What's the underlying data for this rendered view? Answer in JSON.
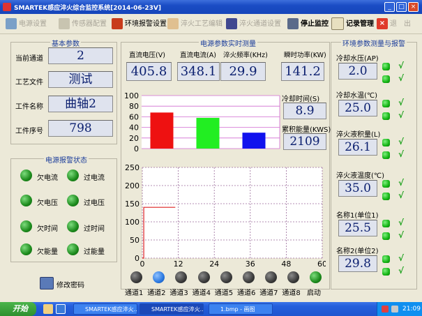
{
  "window": {
    "title": "SMARTEK感应淬火综合监控系统[2014-06-23V]",
    "min": "_",
    "max": "□",
    "close": "×"
  },
  "toolbar": {
    "power_settings": "电源设置",
    "sensor_config": "传感器配置",
    "env_alarm_settings": "环境报警设置",
    "quench_process_edit": "淬火工艺编辑",
    "quench_channel_settings": "淬火通道设置",
    "stop_monitor": "停止监控",
    "record_management": "记录管理",
    "exit": "退",
    "exit2": "出"
  },
  "basic_params": {
    "title": "基本参数",
    "rows": [
      {
        "label": "当前通道",
        "value": "2"
      },
      {
        "label": "工艺文件",
        "value": "测试"
      },
      {
        "label": "工件名称",
        "value": "曲轴2"
      },
      {
        "label": "工件序号",
        "value": "798"
      }
    ]
  },
  "realtime": {
    "title": "电源参数实时测量",
    "metrics": [
      {
        "label": "直流电压(V)",
        "value": "405.8"
      },
      {
        "label": "直流电流(A)",
        "value": "348.1"
      },
      {
        "label": "淬火频率(KHz)",
        "value": "29.9"
      },
      {
        "label": "瞬时功率(KW)",
        "value": "141.2"
      }
    ],
    "cooling_time": {
      "label": "冷却时间(S)",
      "value": "8.9"
    },
    "accum_energy": {
      "label": "累积能量(KWS)",
      "value": "2109"
    }
  },
  "alarm": {
    "title": "电源报警状态",
    "items": [
      "欠电流",
      "过电流",
      "欠电压",
      "过电压",
      "欠时间",
      "过时间",
      "欠能量",
      "过能量"
    ],
    "change_password": "修改密码"
  },
  "environment": {
    "title": "环境参数测量与报警",
    "items": [
      {
        "label": "冷却水压(AP)",
        "value": "2.0"
      },
      {
        "label": "冷却水温(℃)",
        "value": "25.0"
      },
      {
        "label": "淬火液积量(L)",
        "value": "26.1"
      },
      {
        "label": "淬火液温度(℃)",
        "value": "35.0"
      },
      {
        "label": "名称1(单位1)",
        "value": "25.5"
      },
      {
        "label": "名称2(单位2)",
        "value": "29.8"
      }
    ],
    "check_glyph": "√"
  },
  "channels": {
    "labels": [
      "通道1",
      "通道2",
      "通道3",
      "通道4",
      "通道5",
      "通道6",
      "通道7",
      "通道8"
    ],
    "active_index": 1,
    "start_label": "启动"
  },
  "chart_data": [
    {
      "type": "bar",
      "ylim": [
        0,
        100
      ],
      "yticks": [
        "100",
        "80",
        "60",
        "40",
        "20",
        "0"
      ],
      "values": [
        68,
        58,
        30
      ],
      "colors": [
        "#ee1111",
        "#22ee22",
        "#1111ee"
      ]
    },
    {
      "type": "line",
      "xlim": [
        0,
        60
      ],
      "ylim": [
        0,
        250
      ],
      "xticks": [
        "0",
        "12",
        "24",
        "36",
        "48",
        "60"
      ],
      "yticks": [
        "250",
        "200",
        "150",
        "100",
        "50",
        "0"
      ],
      "series": [
        {
          "color": "#dd2222",
          "points": [
            [
              0,
              0
            ],
            [
              0.5,
              0
            ],
            [
              0.5,
              140
            ],
            [
              11,
              140
            ]
          ]
        }
      ]
    }
  ],
  "taskbar": {
    "start": "开始",
    "tasks": [
      "SMARTEK感应淬火...",
      "SMARTEK感应淬火...",
      "1.bmp - 画图"
    ],
    "time": "21:09"
  }
}
